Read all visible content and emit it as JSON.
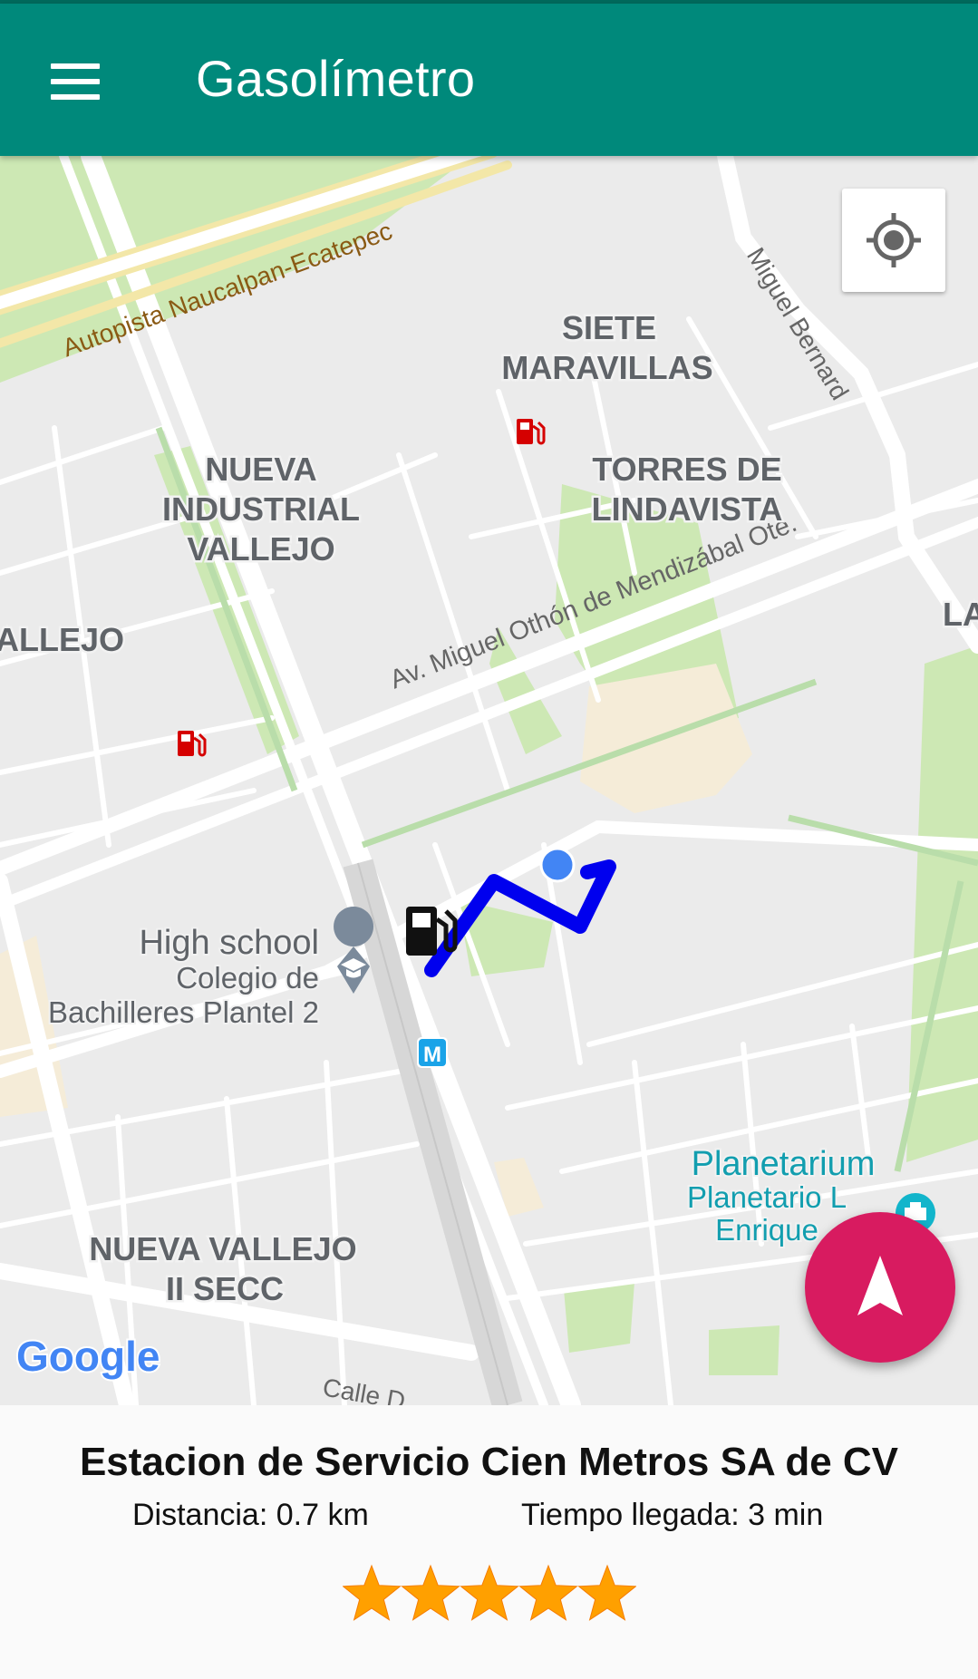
{
  "app_bar": {
    "title": "Gasolímetro",
    "menu_icon": "hamburger-menu-icon"
  },
  "map": {
    "roads": {
      "autopista": "Autopista Naucalpan-Ecatepec",
      "miguel_bernard": "Miguel Bernard",
      "miguel_othon": "Av. Miguel Othón de Mendizábal Ote.",
      "calle": "Calle D"
    },
    "neighborhoods": {
      "siete_maravillas": [
        "SIETE",
        "MARAVILLAS"
      ],
      "torres_lindavista": [
        "TORRES DE",
        "LINDAVISTA"
      ],
      "nueva_industrial": [
        "NUEVA",
        "INDUSTRIAL",
        "VALLEJO"
      ],
      "vallejo_partial": "ALLEJO",
      "nueva_vallejo": [
        "NUEVA VALLEJO",
        "II SECC"
      ],
      "la_partial": "LA"
    },
    "pois": {
      "school": {
        "line1": "High school",
        "line2": "Colegio de",
        "line3": "Bachilleres Plantel 2"
      },
      "planetarium": {
        "title": "Planetarium",
        "line2": "Planetario L",
        "line3": "Enrique"
      }
    },
    "metro_label": "M",
    "route_color": "#0000ee",
    "user_location_color": "#4285f4",
    "gas_pin_color": "#d50000",
    "google_logo": "Google"
  },
  "controls": {
    "my_location_icon": "my-location-icon",
    "navigate_icon": "navigation-arrow-icon",
    "fab_color": "#d81b60"
  },
  "station": {
    "name": "Estacion de Servicio Cien Metros SA de CV",
    "distance": "Distancia: 0.7 km",
    "eta": "Tiempo llegada: 3 min",
    "rating": 5,
    "rating_max": 5
  }
}
